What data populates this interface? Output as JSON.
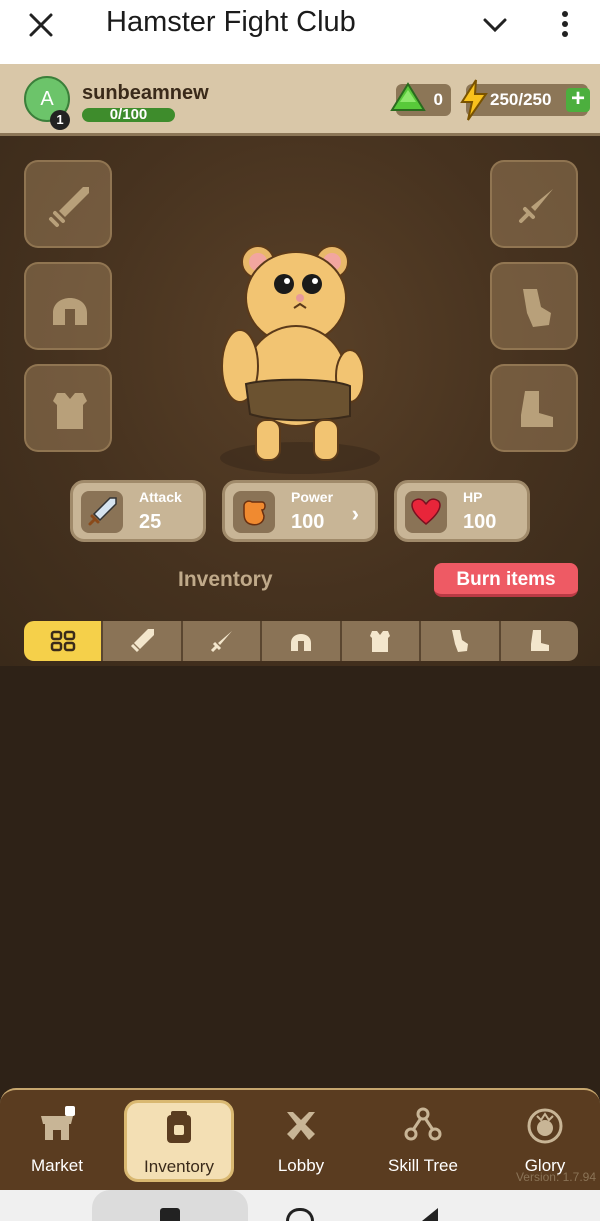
{
  "topbar": {
    "title": "Hamster Fight Club"
  },
  "header": {
    "avatar_letter": "A",
    "level": "1",
    "username": "sunbeamnew",
    "xp": "0/100",
    "gems": "0",
    "energy": "250/250"
  },
  "stats": [
    {
      "label": "Attack",
      "value": "25"
    },
    {
      "label": "Power",
      "value": "100"
    },
    {
      "label": "HP",
      "value": "100"
    }
  ],
  "inventory": {
    "title": "Inventory",
    "burn_label": "Burn items"
  },
  "nav": [
    {
      "label": "Market"
    },
    {
      "label": "Inventory"
    },
    {
      "label": "Lobby"
    },
    {
      "label": "Skill Tree"
    },
    {
      "label": "Glory"
    }
  ],
  "version": "Version: 1.7.94",
  "colors": {
    "accent_yellow": "#f5d04a",
    "burn_red": "#ee5a64",
    "xp_green": "#3e8c2c"
  }
}
